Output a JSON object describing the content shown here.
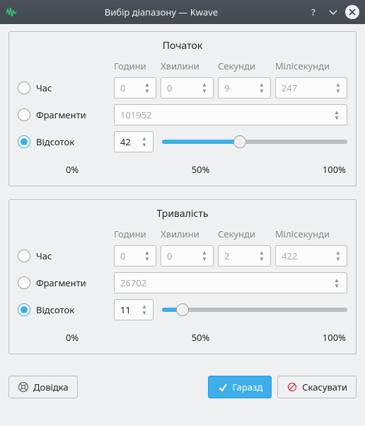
{
  "window": {
    "title": "Вибір діапазону — Kwave"
  },
  "groups": {
    "start": {
      "title": "Початок",
      "headers": {
        "hours": "Години",
        "minutes": "Хвилини",
        "seconds": "Секунди",
        "ms": "Мілісекунди"
      },
      "radios": {
        "time": "Час",
        "frames": "Фрагменти",
        "percent": "Відсоток"
      },
      "selected": "percent",
      "time": {
        "hours": "0",
        "minutes": "0",
        "seconds": "9",
        "ms": "247"
      },
      "frames": "101952",
      "percent": "42",
      "ticks": {
        "t0": "0%",
        "t50": "50%",
        "t100": "100%"
      }
    },
    "length": {
      "title": "Тривалість",
      "headers": {
        "hours": "Години",
        "minutes": "Хвилини",
        "seconds": "Секунди",
        "ms": "Мілісекунди"
      },
      "radios": {
        "time": "Час",
        "frames": "Фрагменти",
        "percent": "Відсоток"
      },
      "selected": "percent",
      "time": {
        "hours": "0",
        "minutes": "0",
        "seconds": "2",
        "ms": "422"
      },
      "frames": "26702",
      "percent": "11",
      "ticks": {
        "t0": "0%",
        "t50": "50%",
        "t100": "100%"
      }
    }
  },
  "buttons": {
    "help": "Довідка",
    "ok": "Гаразд",
    "cancel": "Скасувати"
  },
  "chart_data": {
    "type": "bar",
    "note": "Two percentage sliders on a 0–100 scale",
    "series": [
      {
        "name": "Початок",
        "value": 42
      },
      {
        "name": "Тривалість",
        "value": 11
      }
    ],
    "ticks": [
      0,
      50,
      100
    ],
    "xlim": [
      0,
      100
    ]
  }
}
